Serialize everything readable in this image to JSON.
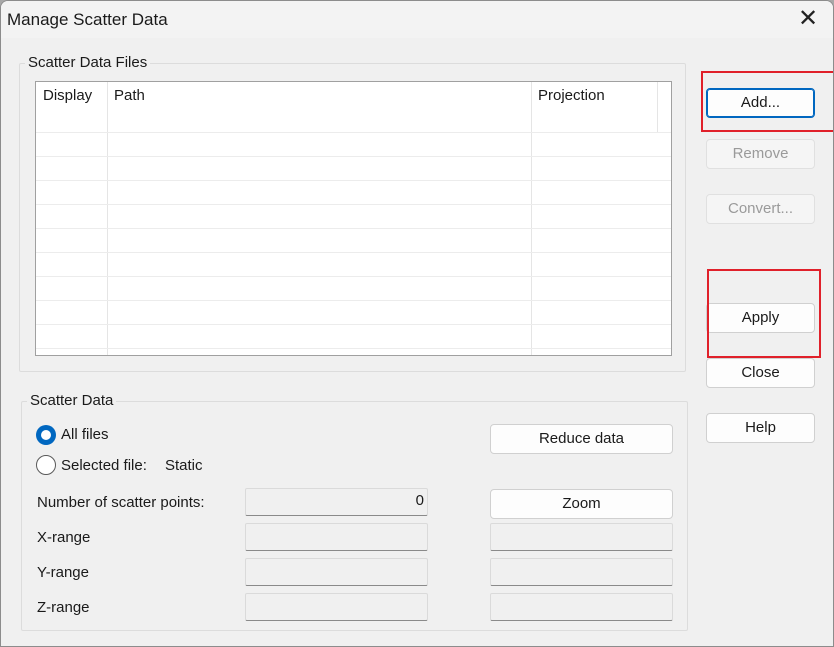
{
  "window": {
    "title": "Manage Scatter Data",
    "close_glyph": "✕"
  },
  "files_group": {
    "label": "Scatter Data Files",
    "columns": [
      "Display",
      "Path",
      "Projection"
    ]
  },
  "buttons": {
    "add": "Add...",
    "remove": "Remove",
    "convert": "Convert...",
    "apply": "Apply",
    "close": "Close",
    "help": "Help"
  },
  "scatter_group": {
    "label": "Scatter Data",
    "all_files": "All files",
    "selected_file": "Selected file:",
    "selected_file_value": "Static",
    "reduce_data": "Reduce data",
    "zoom": "Zoom",
    "num_points_label": "Number of scatter points:",
    "num_points_value": "0",
    "x_range": "X-range",
    "y_range": "Y-range",
    "z_range": "Z-range"
  },
  "colors": {
    "accent": "#0067c0",
    "highlight": "#e0202a"
  }
}
